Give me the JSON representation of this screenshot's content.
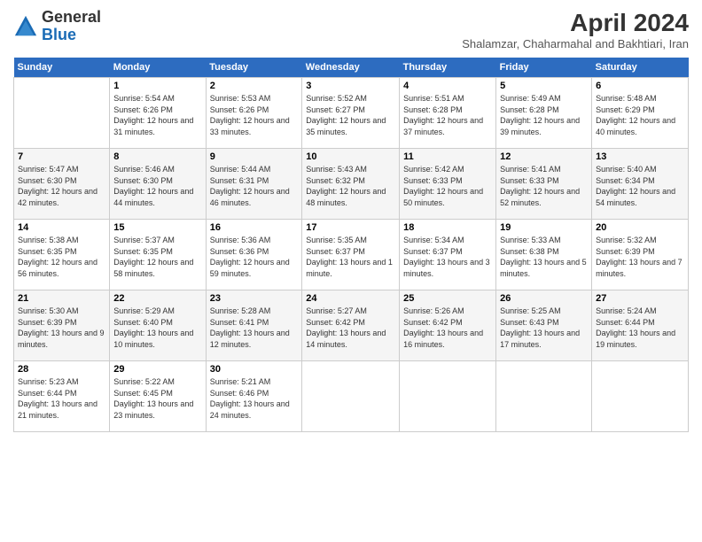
{
  "header": {
    "logo_general": "General",
    "logo_blue": "Blue",
    "month_year": "April 2024",
    "location": "Shalamzar, Chaharmahal and Bakhtiari, Iran"
  },
  "weekdays": [
    "Sunday",
    "Monday",
    "Tuesday",
    "Wednesday",
    "Thursday",
    "Friday",
    "Saturday"
  ],
  "weeks": [
    [
      {
        "day": "",
        "sunrise": "",
        "sunset": "",
        "daylight": ""
      },
      {
        "day": "1",
        "sunrise": "Sunrise: 5:54 AM",
        "sunset": "Sunset: 6:26 PM",
        "daylight": "Daylight: 12 hours and 31 minutes."
      },
      {
        "day": "2",
        "sunrise": "Sunrise: 5:53 AM",
        "sunset": "Sunset: 6:26 PM",
        "daylight": "Daylight: 12 hours and 33 minutes."
      },
      {
        "day": "3",
        "sunrise": "Sunrise: 5:52 AM",
        "sunset": "Sunset: 6:27 PM",
        "daylight": "Daylight: 12 hours and 35 minutes."
      },
      {
        "day": "4",
        "sunrise": "Sunrise: 5:51 AM",
        "sunset": "Sunset: 6:28 PM",
        "daylight": "Daylight: 12 hours and 37 minutes."
      },
      {
        "day": "5",
        "sunrise": "Sunrise: 5:49 AM",
        "sunset": "Sunset: 6:28 PM",
        "daylight": "Daylight: 12 hours and 39 minutes."
      },
      {
        "day": "6",
        "sunrise": "Sunrise: 5:48 AM",
        "sunset": "Sunset: 6:29 PM",
        "daylight": "Daylight: 12 hours and 40 minutes."
      }
    ],
    [
      {
        "day": "7",
        "sunrise": "Sunrise: 5:47 AM",
        "sunset": "Sunset: 6:30 PM",
        "daylight": "Daylight: 12 hours and 42 minutes."
      },
      {
        "day": "8",
        "sunrise": "Sunrise: 5:46 AM",
        "sunset": "Sunset: 6:30 PM",
        "daylight": "Daylight: 12 hours and 44 minutes."
      },
      {
        "day": "9",
        "sunrise": "Sunrise: 5:44 AM",
        "sunset": "Sunset: 6:31 PM",
        "daylight": "Daylight: 12 hours and 46 minutes."
      },
      {
        "day": "10",
        "sunrise": "Sunrise: 5:43 AM",
        "sunset": "Sunset: 6:32 PM",
        "daylight": "Daylight: 12 hours and 48 minutes."
      },
      {
        "day": "11",
        "sunrise": "Sunrise: 5:42 AM",
        "sunset": "Sunset: 6:33 PM",
        "daylight": "Daylight: 12 hours and 50 minutes."
      },
      {
        "day": "12",
        "sunrise": "Sunrise: 5:41 AM",
        "sunset": "Sunset: 6:33 PM",
        "daylight": "Daylight: 12 hours and 52 minutes."
      },
      {
        "day": "13",
        "sunrise": "Sunrise: 5:40 AM",
        "sunset": "Sunset: 6:34 PM",
        "daylight": "Daylight: 12 hours and 54 minutes."
      }
    ],
    [
      {
        "day": "14",
        "sunrise": "Sunrise: 5:38 AM",
        "sunset": "Sunset: 6:35 PM",
        "daylight": "Daylight: 12 hours and 56 minutes."
      },
      {
        "day": "15",
        "sunrise": "Sunrise: 5:37 AM",
        "sunset": "Sunset: 6:35 PM",
        "daylight": "Daylight: 12 hours and 58 minutes."
      },
      {
        "day": "16",
        "sunrise": "Sunrise: 5:36 AM",
        "sunset": "Sunset: 6:36 PM",
        "daylight": "Daylight: 12 hours and 59 minutes."
      },
      {
        "day": "17",
        "sunrise": "Sunrise: 5:35 AM",
        "sunset": "Sunset: 6:37 PM",
        "daylight": "Daylight: 13 hours and 1 minute."
      },
      {
        "day": "18",
        "sunrise": "Sunrise: 5:34 AM",
        "sunset": "Sunset: 6:37 PM",
        "daylight": "Daylight: 13 hours and 3 minutes."
      },
      {
        "day": "19",
        "sunrise": "Sunrise: 5:33 AM",
        "sunset": "Sunset: 6:38 PM",
        "daylight": "Daylight: 13 hours and 5 minutes."
      },
      {
        "day": "20",
        "sunrise": "Sunrise: 5:32 AM",
        "sunset": "Sunset: 6:39 PM",
        "daylight": "Daylight: 13 hours and 7 minutes."
      }
    ],
    [
      {
        "day": "21",
        "sunrise": "Sunrise: 5:30 AM",
        "sunset": "Sunset: 6:39 PM",
        "daylight": "Daylight: 13 hours and 9 minutes."
      },
      {
        "day": "22",
        "sunrise": "Sunrise: 5:29 AM",
        "sunset": "Sunset: 6:40 PM",
        "daylight": "Daylight: 13 hours and 10 minutes."
      },
      {
        "day": "23",
        "sunrise": "Sunrise: 5:28 AM",
        "sunset": "Sunset: 6:41 PM",
        "daylight": "Daylight: 13 hours and 12 minutes."
      },
      {
        "day": "24",
        "sunrise": "Sunrise: 5:27 AM",
        "sunset": "Sunset: 6:42 PM",
        "daylight": "Daylight: 13 hours and 14 minutes."
      },
      {
        "day": "25",
        "sunrise": "Sunrise: 5:26 AM",
        "sunset": "Sunset: 6:42 PM",
        "daylight": "Daylight: 13 hours and 16 minutes."
      },
      {
        "day": "26",
        "sunrise": "Sunrise: 5:25 AM",
        "sunset": "Sunset: 6:43 PM",
        "daylight": "Daylight: 13 hours and 17 minutes."
      },
      {
        "day": "27",
        "sunrise": "Sunrise: 5:24 AM",
        "sunset": "Sunset: 6:44 PM",
        "daylight": "Daylight: 13 hours and 19 minutes."
      }
    ],
    [
      {
        "day": "28",
        "sunrise": "Sunrise: 5:23 AM",
        "sunset": "Sunset: 6:44 PM",
        "daylight": "Daylight: 13 hours and 21 minutes."
      },
      {
        "day": "29",
        "sunrise": "Sunrise: 5:22 AM",
        "sunset": "Sunset: 6:45 PM",
        "daylight": "Daylight: 13 hours and 23 minutes."
      },
      {
        "day": "30",
        "sunrise": "Sunrise: 5:21 AM",
        "sunset": "Sunset: 6:46 PM",
        "daylight": "Daylight: 13 hours and 24 minutes."
      },
      {
        "day": "",
        "sunrise": "",
        "sunset": "",
        "daylight": ""
      },
      {
        "day": "",
        "sunrise": "",
        "sunset": "",
        "daylight": ""
      },
      {
        "day": "",
        "sunrise": "",
        "sunset": "",
        "daylight": ""
      },
      {
        "day": "",
        "sunrise": "",
        "sunset": "",
        "daylight": ""
      }
    ]
  ]
}
